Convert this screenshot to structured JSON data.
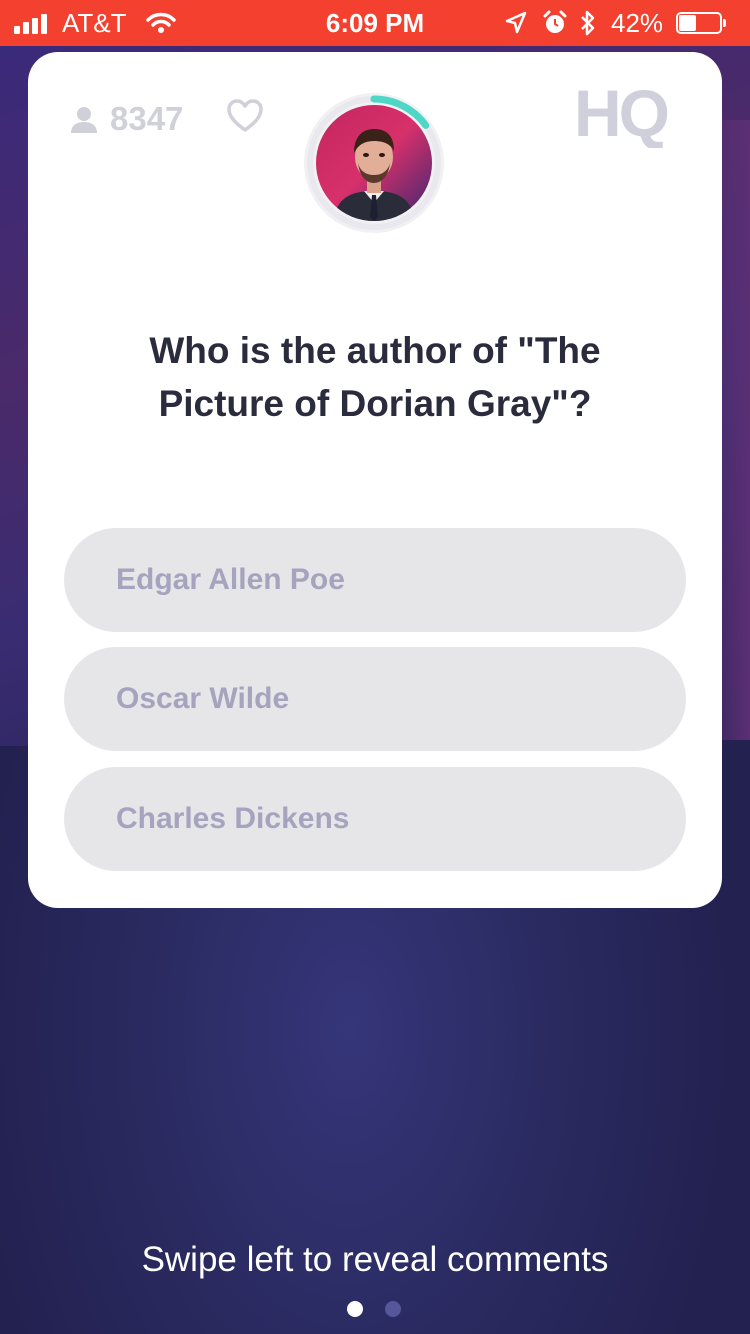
{
  "status_bar": {
    "carrier": "AT&T",
    "time": "6:09 PM",
    "battery_percent": "42%",
    "battery_level": 0.42,
    "background_color": "#f4402f"
  },
  "game": {
    "viewer_count": "8347",
    "logo_text": "HQ",
    "timer_remaining_fraction": 0.15,
    "timer_color": "#4ed6c6",
    "question": "Who is the author of \"The Picture of Dorian Gray\"?",
    "options": [
      {
        "label": "Edgar Allen Poe"
      },
      {
        "label": "Oscar Wilde"
      },
      {
        "label": "Charles Dickens"
      }
    ]
  },
  "footer": {
    "hint": "Swipe left to reveal comments",
    "page_count": 2,
    "active_page": 1
  },
  "icons": [
    "signal-icon",
    "wifi-icon",
    "location-arrow-icon",
    "alarm-icon",
    "bluetooth-icon",
    "battery-icon",
    "user-icon",
    "heart-icon"
  ]
}
